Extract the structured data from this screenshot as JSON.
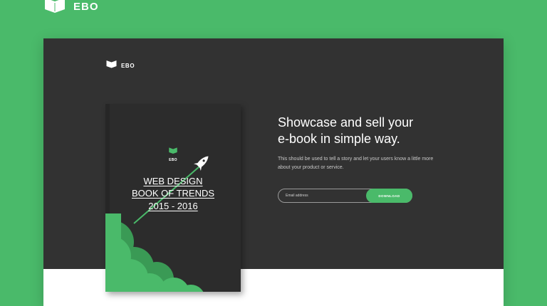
{
  "brand": {
    "name": "EBO"
  },
  "inner_brand": {
    "name": "EBO"
  },
  "book": {
    "logo_text": "EBO",
    "title_line1": "WEB DESIGN",
    "title_line2": "BOOK OF TRENDS",
    "title_line3": "2015 - 2016"
  },
  "hero": {
    "headline_line1": "Showcase and sell your",
    "headline_line2": "e-book in simple way.",
    "subtext": "This should be used to tell a story and let your users know a little more about your product or service."
  },
  "signup": {
    "email_placeholder": "Email address",
    "button_label": "DOWNLOAD"
  },
  "colors": {
    "accent": "#4aba6a",
    "dark_panel": "#323232",
    "book_cover": "#2c2c2c"
  },
  "icons": {
    "brand": "open-book-logo-icon",
    "rocket": "rocket-icon"
  }
}
